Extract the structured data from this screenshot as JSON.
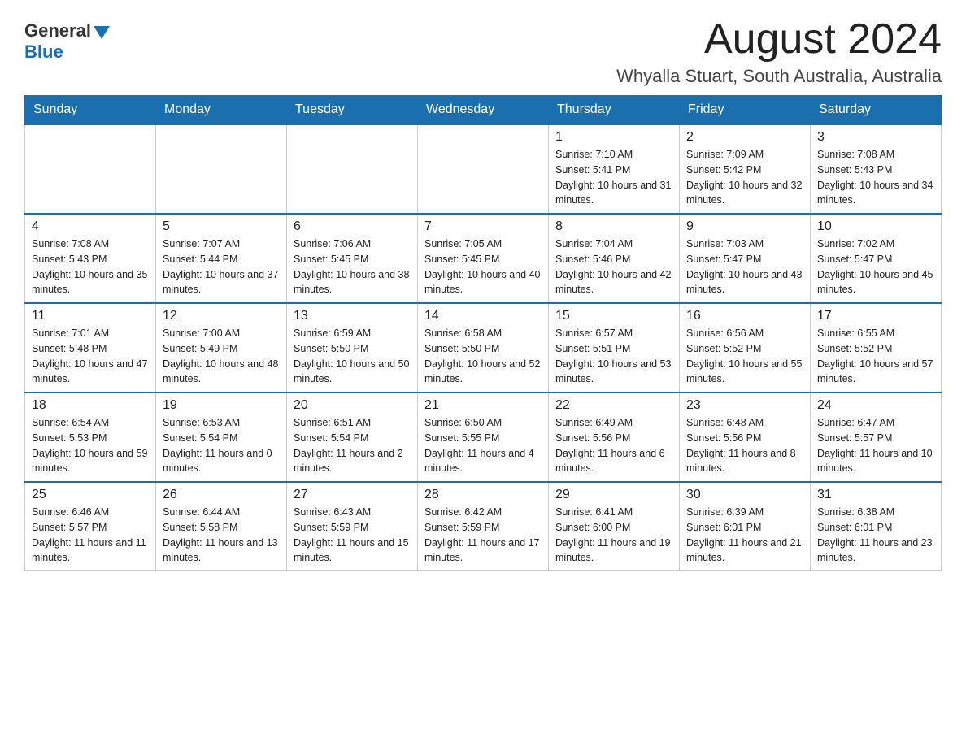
{
  "header": {
    "logo": {
      "text_general": "General",
      "text_blue": "Blue",
      "arrow": true
    },
    "month_title": "August 2024",
    "location": "Whyalla Stuart, South Australia, Australia"
  },
  "calendar": {
    "days_of_week": [
      "Sunday",
      "Monday",
      "Tuesday",
      "Wednesday",
      "Thursday",
      "Friday",
      "Saturday"
    ],
    "weeks": [
      [
        {
          "day": "",
          "info": ""
        },
        {
          "day": "",
          "info": ""
        },
        {
          "day": "",
          "info": ""
        },
        {
          "day": "",
          "info": ""
        },
        {
          "day": "1",
          "info": "Sunrise: 7:10 AM\nSunset: 5:41 PM\nDaylight: 10 hours and 31 minutes."
        },
        {
          "day": "2",
          "info": "Sunrise: 7:09 AM\nSunset: 5:42 PM\nDaylight: 10 hours and 32 minutes."
        },
        {
          "day": "3",
          "info": "Sunrise: 7:08 AM\nSunset: 5:43 PM\nDaylight: 10 hours and 34 minutes."
        }
      ],
      [
        {
          "day": "4",
          "info": "Sunrise: 7:08 AM\nSunset: 5:43 PM\nDaylight: 10 hours and 35 minutes."
        },
        {
          "day": "5",
          "info": "Sunrise: 7:07 AM\nSunset: 5:44 PM\nDaylight: 10 hours and 37 minutes."
        },
        {
          "day": "6",
          "info": "Sunrise: 7:06 AM\nSunset: 5:45 PM\nDaylight: 10 hours and 38 minutes."
        },
        {
          "day": "7",
          "info": "Sunrise: 7:05 AM\nSunset: 5:45 PM\nDaylight: 10 hours and 40 minutes."
        },
        {
          "day": "8",
          "info": "Sunrise: 7:04 AM\nSunset: 5:46 PM\nDaylight: 10 hours and 42 minutes."
        },
        {
          "day": "9",
          "info": "Sunrise: 7:03 AM\nSunset: 5:47 PM\nDaylight: 10 hours and 43 minutes."
        },
        {
          "day": "10",
          "info": "Sunrise: 7:02 AM\nSunset: 5:47 PM\nDaylight: 10 hours and 45 minutes."
        }
      ],
      [
        {
          "day": "11",
          "info": "Sunrise: 7:01 AM\nSunset: 5:48 PM\nDaylight: 10 hours and 47 minutes."
        },
        {
          "day": "12",
          "info": "Sunrise: 7:00 AM\nSunset: 5:49 PM\nDaylight: 10 hours and 48 minutes."
        },
        {
          "day": "13",
          "info": "Sunrise: 6:59 AM\nSunset: 5:50 PM\nDaylight: 10 hours and 50 minutes."
        },
        {
          "day": "14",
          "info": "Sunrise: 6:58 AM\nSunset: 5:50 PM\nDaylight: 10 hours and 52 minutes."
        },
        {
          "day": "15",
          "info": "Sunrise: 6:57 AM\nSunset: 5:51 PM\nDaylight: 10 hours and 53 minutes."
        },
        {
          "day": "16",
          "info": "Sunrise: 6:56 AM\nSunset: 5:52 PM\nDaylight: 10 hours and 55 minutes."
        },
        {
          "day": "17",
          "info": "Sunrise: 6:55 AM\nSunset: 5:52 PM\nDaylight: 10 hours and 57 minutes."
        }
      ],
      [
        {
          "day": "18",
          "info": "Sunrise: 6:54 AM\nSunset: 5:53 PM\nDaylight: 10 hours and 59 minutes."
        },
        {
          "day": "19",
          "info": "Sunrise: 6:53 AM\nSunset: 5:54 PM\nDaylight: 11 hours and 0 minutes."
        },
        {
          "day": "20",
          "info": "Sunrise: 6:51 AM\nSunset: 5:54 PM\nDaylight: 11 hours and 2 minutes."
        },
        {
          "day": "21",
          "info": "Sunrise: 6:50 AM\nSunset: 5:55 PM\nDaylight: 11 hours and 4 minutes."
        },
        {
          "day": "22",
          "info": "Sunrise: 6:49 AM\nSunset: 5:56 PM\nDaylight: 11 hours and 6 minutes."
        },
        {
          "day": "23",
          "info": "Sunrise: 6:48 AM\nSunset: 5:56 PM\nDaylight: 11 hours and 8 minutes."
        },
        {
          "day": "24",
          "info": "Sunrise: 6:47 AM\nSunset: 5:57 PM\nDaylight: 11 hours and 10 minutes."
        }
      ],
      [
        {
          "day": "25",
          "info": "Sunrise: 6:46 AM\nSunset: 5:57 PM\nDaylight: 11 hours and 11 minutes."
        },
        {
          "day": "26",
          "info": "Sunrise: 6:44 AM\nSunset: 5:58 PM\nDaylight: 11 hours and 13 minutes."
        },
        {
          "day": "27",
          "info": "Sunrise: 6:43 AM\nSunset: 5:59 PM\nDaylight: 11 hours and 15 minutes."
        },
        {
          "day": "28",
          "info": "Sunrise: 6:42 AM\nSunset: 5:59 PM\nDaylight: 11 hours and 17 minutes."
        },
        {
          "day": "29",
          "info": "Sunrise: 6:41 AM\nSunset: 6:00 PM\nDaylight: 11 hours and 19 minutes."
        },
        {
          "day": "30",
          "info": "Sunrise: 6:39 AM\nSunset: 6:01 PM\nDaylight: 11 hours and 21 minutes."
        },
        {
          "day": "31",
          "info": "Sunrise: 6:38 AM\nSunset: 6:01 PM\nDaylight: 11 hours and 23 minutes."
        }
      ]
    ]
  }
}
